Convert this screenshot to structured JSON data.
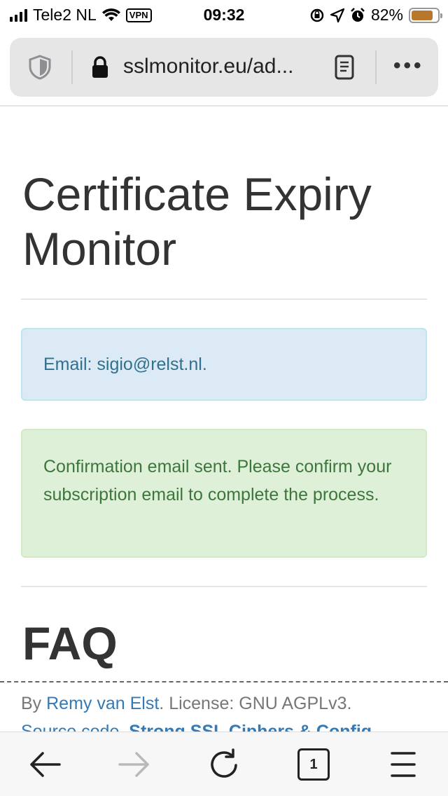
{
  "status_bar": {
    "carrier": "Tele2 NL",
    "vpn": "VPN",
    "time": "09:32",
    "battery_percent": "82%",
    "battery_level": 0.82,
    "battery_color": "#b9772e"
  },
  "browser": {
    "url": "sslmonitor.eu/ad...",
    "icons": [
      "shield-icon",
      "lock-icon",
      "reader-view-icon",
      "more-icon"
    ],
    "more_label": "•••"
  },
  "page": {
    "title": "Certificate Expiry Monitor",
    "info_alert": "Email: sigio@relst.nl.",
    "success_alert": "Confirmation email sent. Please confirm your subscription email to complete the process.",
    "faq_heading": "FAQ",
    "footer": {
      "by": "By ",
      "author": "Remy van Elst",
      "license": ". License: GNU AGPLv3.",
      "source": "Source code",
      "separator": ". ",
      "strong_ssl": "Strong SSL Ciphers & Config"
    }
  },
  "toolbar": {
    "tabs_count": "1",
    "icons": [
      "back-arrow-icon",
      "forward-arrow-icon",
      "reload-icon",
      "tabs-icon",
      "menu-icon"
    ]
  },
  "colors": {
    "info_bg": "#dbeaf5",
    "info_text": "#31708f",
    "success_bg": "#dff0d8",
    "success_text": "#3c763d",
    "link": "#337ab7"
  }
}
